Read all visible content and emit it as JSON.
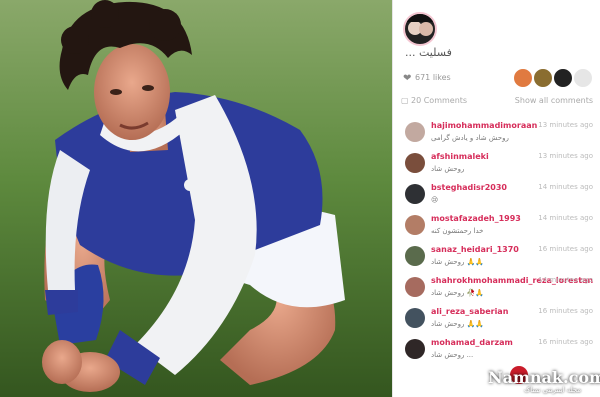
{
  "post": {
    "caption": "... فسلیت",
    "likes": "671 likes",
    "comment_count": "20 Comments",
    "show_all": "Show all comments",
    "comments": [
      {
        "user": "hajimohammadimoraan",
        "text": "روحش شاد و یادش گرامی",
        "time": "13 minutes ago",
        "avatar": "#c2a9a0"
      },
      {
        "user": "afshinmaleki",
        "text": "روحش شاد",
        "time": "13 minutes ago",
        "avatar": "#7a4e3c"
      },
      {
        "user": "bsteghadisr2030",
        "text": "😢",
        "time": "14 minutes ago",
        "avatar": "#2e3034"
      },
      {
        "user": "mostafazadeh_1993",
        "text": "خدا رحمتشون کنه",
        "time": "14 minutes ago",
        "avatar": "#b37d66"
      },
      {
        "user": "sanaz_heidari_1370",
        "text": "روحش شاد 🙏🙏",
        "time": "16 minutes ago",
        "avatar": "#5a6b4c"
      },
      {
        "user": "shahrokhmohammadi_reza_lorestan",
        "text": "روحش شاد 🥀🙏",
        "time": "14 minutes ago",
        "avatar": "#a66b5f"
      },
      {
        "user": "ali_reza_saberian",
        "text": "روحش شاد 🙏🙏",
        "time": "16 minutes ago",
        "avatar": "#43525f"
      },
      {
        "user": "mohamad_darzam",
        "text": "روحش شاد ...",
        "time": "16 minutes ago",
        "avatar": "#2f2727"
      }
    ]
  },
  "watermark": {
    "name": "Namnak.com",
    "sub": "مجله اینترنتی نمناک"
  },
  "colors": {
    "username": "#d62d5a",
    "likers": [
      "#e07a40",
      "#8a6d30",
      "#222222",
      "#e6e6e6",
      "#3c3c3c"
    ]
  }
}
